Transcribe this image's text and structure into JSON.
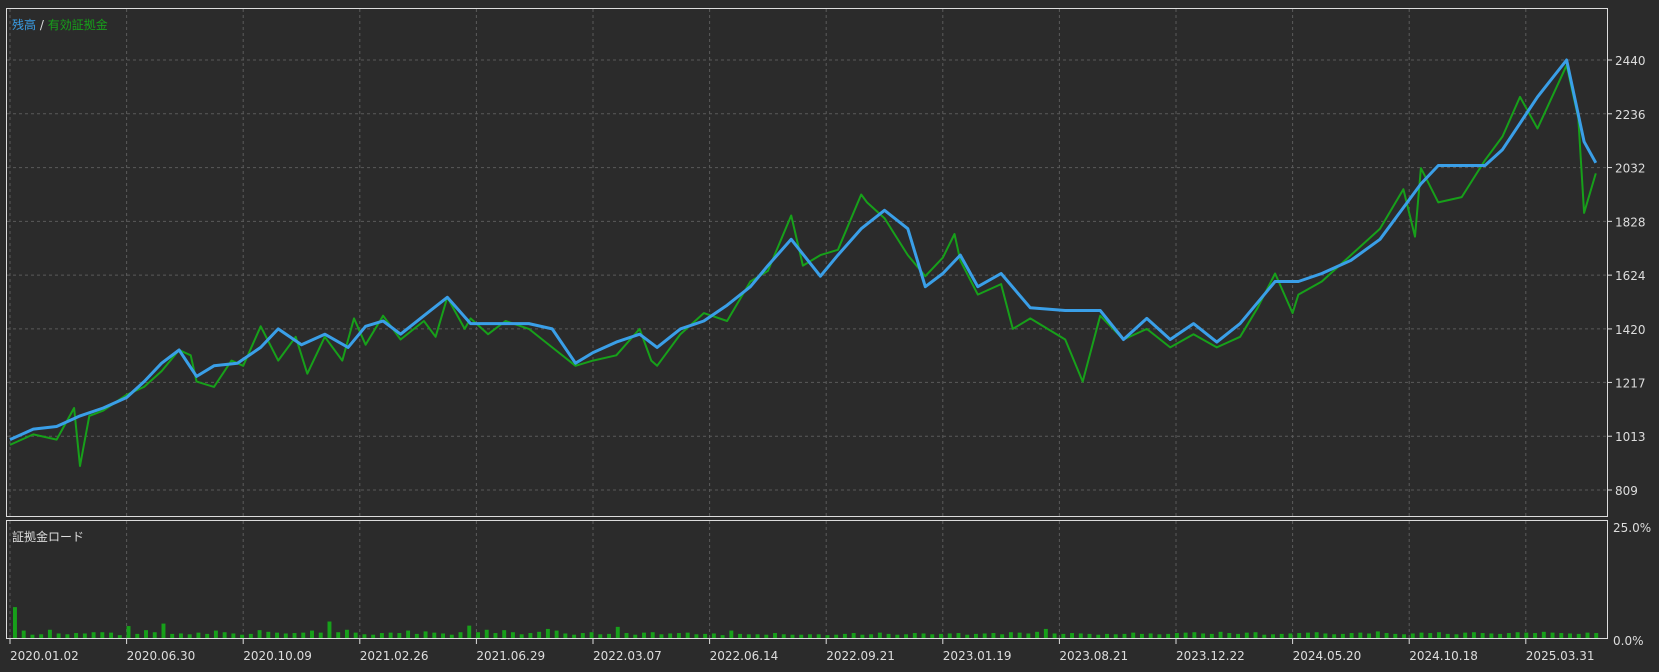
{
  "chart_data": [
    {
      "type": "line",
      "legend": {
        "parts": [
          "残高",
          " / ",
          "有効証拠金"
        ],
        "placement": "top-left"
      },
      "colors": {
        "balance": "#3a9fe8",
        "equity": "#17a01a",
        "grid": "#5a5a5a",
        "frame": "#dddddd",
        "background": "#2b2b2b"
      },
      "grid": true,
      "ylim": [
        809,
        2440
      ],
      "y_ticks": [
        "2440",
        "2236",
        "2032",
        "1828",
        "1624",
        "1420",
        "1217",
        "1013",
        "809"
      ],
      "x_ticks": [
        "2020.01.02",
        "2020.06.30",
        "2020.10.09",
        "2021.02.26",
        "2021.06.29",
        "2022.03.07",
        "2022.06.14",
        "2022.09.21",
        "2023.01.19",
        "2023.08.21",
        "2023.12.22",
        "2024.05.20",
        "2024.10.18",
        "2025.03.31"
      ],
      "series": [
        {
          "name": "残高",
          "x": [
            0.0,
            0.2,
            0.4,
            0.6,
            0.8,
            1.0,
            1.15,
            1.3,
            1.45,
            1.6,
            1.75,
            1.95,
            2.15,
            2.3,
            2.5,
            2.7,
            2.9,
            3.05,
            3.2,
            3.35,
            3.55,
            3.75,
            3.95,
            4.1,
            4.25,
            4.45,
            4.65,
            4.85,
            5.0,
            5.2,
            5.4,
            5.55,
            5.75,
            5.95,
            6.15,
            6.35,
            6.5,
            6.7,
            6.95,
            7.1,
            7.3,
            7.5,
            7.7,
            7.85,
            8.0,
            8.15,
            8.3,
            8.5,
            8.75,
            9.05,
            9.35,
            9.55,
            9.75,
            9.95,
            10.15,
            10.35,
            10.55,
            10.7,
            10.85,
            11.05,
            11.25,
            11.5,
            11.75,
            11.95,
            12.1,
            12.25,
            12.45,
            12.65,
            12.8,
            12.95,
            13.1,
            13.35,
            13.5,
            13.6
          ],
          "values": [
            1000,
            1040,
            1050,
            1090,
            1120,
            1160,
            1220,
            1290,
            1340,
            1240,
            1280,
            1290,
            1350,
            1420,
            1360,
            1400,
            1350,
            1430,
            1450,
            1400,
            1470,
            1540,
            1440,
            1440,
            1440,
            1440,
            1420,
            1290,
            1330,
            1370,
            1400,
            1350,
            1420,
            1450,
            1510,
            1580,
            1660,
            1760,
            1620,
            1700,
            1800,
            1870,
            1800,
            1580,
            1630,
            1700,
            1580,
            1630,
            1500,
            1490,
            1490,
            1380,
            1460,
            1380,
            1440,
            1370,
            1440,
            1520,
            1600,
            1600,
            1630,
            1680,
            1760,
            1880,
            1970,
            2040,
            2040,
            2040,
            2100,
            2200,
            2300,
            2440,
            2130,
            2050
          ]
        },
        {
          "name": "有効証拠金",
          "x": [
            0.0,
            0.2,
            0.4,
            0.55,
            0.6,
            0.68,
            0.8,
            1.0,
            1.15,
            1.3,
            1.45,
            1.55,
            1.6,
            1.75,
            1.9,
            2.0,
            2.15,
            2.3,
            2.45,
            2.55,
            2.7,
            2.85,
            2.95,
            3.05,
            3.2,
            3.35,
            3.55,
            3.65,
            3.75,
            3.9,
            3.95,
            4.1,
            4.25,
            4.45,
            4.65,
            4.85,
            5.0,
            5.2,
            5.4,
            5.5,
            5.55,
            5.75,
            5.95,
            6.15,
            6.35,
            6.5,
            6.7,
            6.8,
            6.95,
            7.1,
            7.3,
            7.35,
            7.5,
            7.7,
            7.85,
            8.0,
            8.1,
            8.15,
            8.3,
            8.5,
            8.6,
            8.75,
            9.05,
            9.2,
            9.35,
            9.55,
            9.75,
            9.95,
            10.15,
            10.35,
            10.55,
            10.7,
            10.85,
            11.0,
            11.05,
            11.25,
            11.5,
            11.75,
            11.95,
            12.05,
            12.1,
            12.25,
            12.45,
            12.65,
            12.8,
            12.95,
            13.1,
            13.35,
            13.45,
            13.5,
            13.6
          ],
          "values": [
            980,
            1020,
            1000,
            1120,
            900,
            1090,
            1110,
            1170,
            1200,
            1260,
            1340,
            1320,
            1220,
            1200,
            1300,
            1280,
            1430,
            1300,
            1390,
            1250,
            1390,
            1300,
            1460,
            1360,
            1470,
            1380,
            1450,
            1390,
            1540,
            1420,
            1460,
            1400,
            1450,
            1420,
            1350,
            1280,
            1300,
            1320,
            1420,
            1300,
            1280,
            1400,
            1480,
            1450,
            1600,
            1640,
            1850,
            1660,
            1700,
            1720,
            1930,
            1900,
            1840,
            1700,
            1620,
            1690,
            1780,
            1680,
            1550,
            1590,
            1420,
            1460,
            1380,
            1220,
            1470,
            1380,
            1420,
            1350,
            1400,
            1350,
            1390,
            1500,
            1630,
            1480,
            1550,
            1600,
            1700,
            1800,
            1950,
            1770,
            2030,
            1900,
            1920,
            2060,
            2150,
            2300,
            2180,
            2420,
            2220,
            1860,
            2010
          ]
        }
      ]
    },
    {
      "type": "bar",
      "title": "証拠金ロード",
      "ylim": [
        0,
        25
      ],
      "y_ticks": [
        "25.0%",
        "0.0%"
      ],
      "values": [
        7.5,
        1.8,
        0.8,
        0.9,
        2.0,
        1.1,
        0.9,
        1.2,
        1.1,
        1.4,
        1.4,
        1.3,
        0.7,
        2.9,
        1.0,
        1.9,
        1.4,
        3.5,
        1.0,
        1.1,
        0.9,
        1.3,
        1.0,
        1.8,
        1.4,
        1.1,
        0.8,
        1.0,
        1.9,
        1.5,
        1.3,
        1.1,
        1.2,
        1.3,
        1.8,
        1.3,
        4.0,
        1.4,
        2.0,
        1.3,
        0.9,
        0.8,
        1.2,
        1.3,
        1.2,
        1.8,
        1.0,
        1.6,
        1.3,
        1.1,
        0.8,
        1.4,
        3.0,
        1.4,
        2.0,
        1.2,
        1.9,
        1.4,
        0.9,
        1.2,
        1.5,
        2.2,
        1.8,
        1.1,
        0.8,
        1.2,
        1.4,
        0.9,
        1.0,
        2.7,
        1.2,
        0.8,
        1.3,
        1.4,
        0.9,
        1.1,
        1.2,
        1.3,
        0.9,
        1.0,
        1.1,
        0.7,
        1.8,
        1.0,
        0.9,
        0.9,
        0.8,
        1.2,
        0.9,
        0.8,
        0.8,
        0.9,
        0.9,
        0.7,
        0.8,
        1.0,
        1.2,
        0.8,
        0.9,
        1.3,
        1.0,
        0.8,
        0.9,
        1.2,
        1.1,
        0.9,
        1.0,
        1.1,
        1.2,
        0.8,
        1.0,
        1.1,
        1.2,
        0.9,
        1.4,
        1.3,
        1.1,
        1.5,
        2.2,
        1.1,
        1.0,
        1.2,
        1.1,
        1.0,
        0.8,
        1.0,
        0.9,
        1.0,
        1.3,
        1.0,
        1.1,
        0.9,
        1.0,
        1.2,
        1.3,
        1.4,
        1.1,
        1.0,
        1.5,
        1.2,
        1.0,
        1.3,
        1.4,
        0.8,
        0.9,
        1.0,
        1.1,
        1.2,
        1.3,
        1.4,
        1.1,
        0.9,
        1.0,
        1.2,
        1.3,
        1.1,
        1.6,
        1.2,
        1.0,
        0.9,
        1.1,
        1.3,
        1.2,
        1.4,
        1.0,
        0.9,
        1.3,
        1.4,
        1.2,
        1.1,
        1.0,
        1.2,
        1.4,
        1.3,
        1.2,
        1.5,
        1.3,
        1.2,
        1.1,
        1.0,
        1.3,
        1.2
      ]
    }
  ]
}
